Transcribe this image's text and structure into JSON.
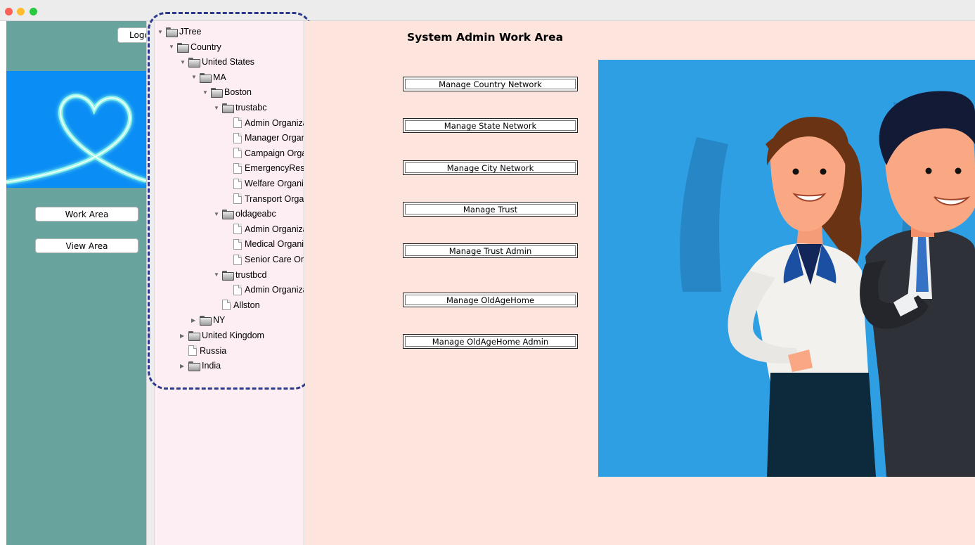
{
  "window": {
    "buttons": [
      "close",
      "minimize",
      "zoom"
    ]
  },
  "left_panel": {
    "logout_label": "Logout",
    "work_area_label": "Work Area",
    "view_area_label": "View Area"
  },
  "tree": {
    "nodes": [
      {
        "label": "JTree",
        "type": "folder",
        "expanded": true,
        "depth": 0
      },
      {
        "label": "Country",
        "type": "folder",
        "expanded": true,
        "depth": 1
      },
      {
        "label": "United States",
        "type": "folder",
        "expanded": true,
        "depth": 2
      },
      {
        "label": "MA",
        "type": "folder",
        "expanded": true,
        "depth": 3
      },
      {
        "label": "Boston",
        "type": "folder",
        "expanded": true,
        "depth": 4
      },
      {
        "label": "trustabc",
        "type": "folder",
        "expanded": true,
        "depth": 5
      },
      {
        "label": "Admin Organization",
        "type": "leaf",
        "depth": 6
      },
      {
        "label": "Manager Organization",
        "type": "leaf",
        "depth": 6
      },
      {
        "label": "Campaign Organization",
        "type": "leaf",
        "depth": 6
      },
      {
        "label": "EmergencyResponse",
        "type": "leaf",
        "depth": 6
      },
      {
        "label": "Welfare Organization",
        "type": "leaf",
        "depth": 6
      },
      {
        "label": "Transport Organization",
        "type": "leaf",
        "depth": 6
      },
      {
        "label": "oldageabc",
        "type": "folder",
        "expanded": true,
        "depth": 5
      },
      {
        "label": "Admin Organization",
        "type": "leaf",
        "depth": 6
      },
      {
        "label": "Medical Organization",
        "type": "leaf",
        "depth": 6
      },
      {
        "label": "Senior Care Organization",
        "type": "leaf",
        "depth": 6
      },
      {
        "label": "trustbcd",
        "type": "folder",
        "expanded": true,
        "depth": 5
      },
      {
        "label": "Admin Organization",
        "type": "leaf",
        "depth": 6
      },
      {
        "label": "Allston",
        "type": "leaf",
        "depth": 5
      },
      {
        "label": "NY",
        "type": "folder",
        "expanded": false,
        "depth": 3
      },
      {
        "label": "United Kingdom",
        "type": "folder",
        "expanded": false,
        "depth": 2
      },
      {
        "label": "Russia",
        "type": "leaf",
        "depth": 2
      },
      {
        "label": "India",
        "type": "folder",
        "expanded": false,
        "depth": 2
      }
    ]
  },
  "work_area": {
    "title": "System Admin Work Area",
    "buttons": [
      {
        "label": "Manage Country Network"
      },
      {
        "label": "Manage State Network"
      },
      {
        "label": "Manage City Network"
      },
      {
        "label": "Manage Trust"
      },
      {
        "label": "Manage Trust Admin"
      },
      {
        "label": "Manage OldAgeHome"
      },
      {
        "label": "Manage OldAgeHome Admin"
      }
    ]
  },
  "colors": {
    "left_panel_bg": "#68a39e",
    "tree_bg": "#fdeef3",
    "work_area_bg": "#fde4dc",
    "banner_bg": "#0a8ef5",
    "illustration_bg": "#2f9fe4",
    "outline": "#2d3a8c"
  }
}
